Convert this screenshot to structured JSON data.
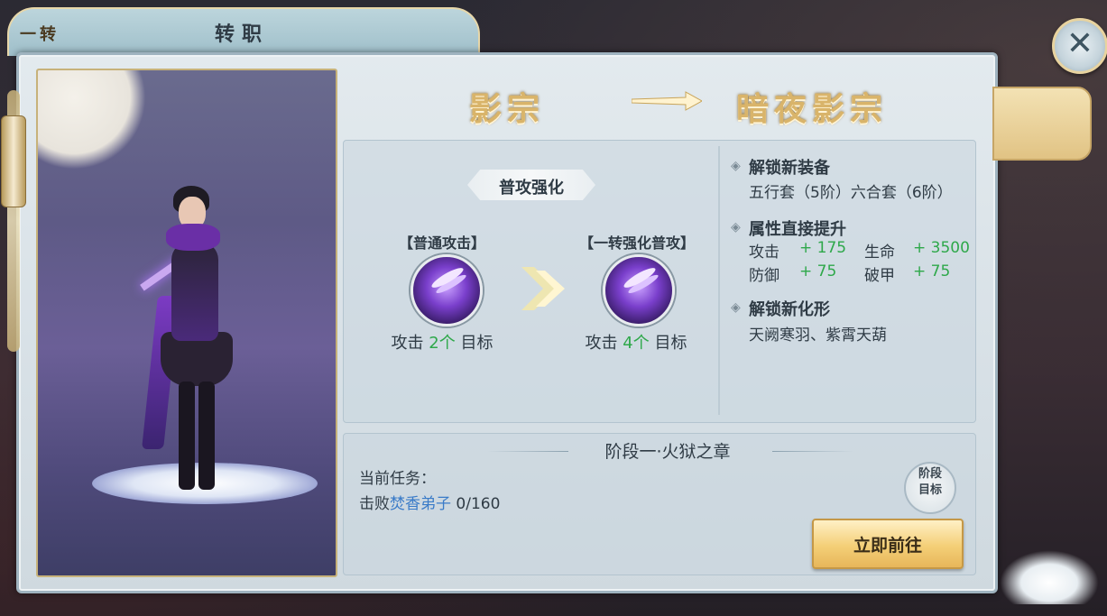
{
  "window": {
    "title": "转职",
    "close_icon": "close-icon"
  },
  "class_change": {
    "from": "影宗",
    "to": "暗夜影宗",
    "arrow_icon": "arrow-right-icon"
  },
  "side_tab": {
    "label": "一转"
  },
  "skill_upgrade": {
    "tag": "普攻强化",
    "before": {
      "name": "【普通攻击】",
      "icon": "slash-skill-icon",
      "target_prefix": "攻击",
      "target_count": "2个",
      "target_suffix": "目标"
    },
    "after": {
      "name": "【一转强化普攻】",
      "icon": "enhanced-slash-skill-icon",
      "target_prefix": "攻击",
      "target_count": "4个",
      "target_suffix": "目标"
    }
  },
  "unlocks": {
    "equipment_head": "解锁新装备",
    "equipment_text": "五行套（5阶）六合套（6阶）",
    "attributes_head": "属性直接提升",
    "stats": [
      {
        "label": "攻击",
        "value": "+ 175"
      },
      {
        "label": "生命",
        "value": "+ 3500"
      },
      {
        "label": "防御",
        "value": "+ 75"
      },
      {
        "label": "破甲",
        "value": "+ 75"
      }
    ],
    "form_head": "解锁新化形",
    "form_text": "天阙寒羽、紫霄天葫"
  },
  "task": {
    "stage_title": "阶段一·火狱之章",
    "current_label": "当前任务：",
    "desc_prefix": "击败",
    "desc_target": "焚香弟子",
    "progress": "0/160",
    "stage_goal_label": "阶段\n目标",
    "go_button": "立即前往"
  },
  "colors": {
    "accent_gold": "#d9b46a",
    "stat_green": "#2ea84a",
    "task_blue": "#3a7bc8"
  }
}
